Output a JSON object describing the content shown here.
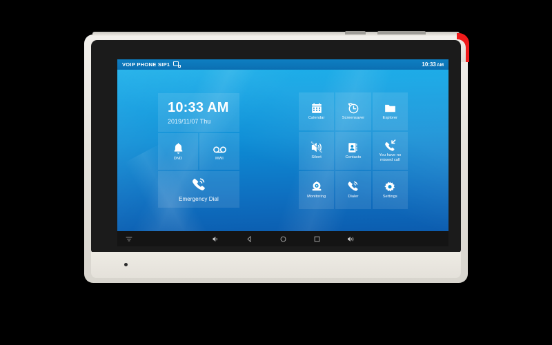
{
  "device": {
    "name": "voip-video-phone",
    "accent_color": "#f01b1b",
    "bezel_color": "#1b1b1b",
    "body_color": "#e9e6df"
  },
  "screen": {
    "background_colors": [
      "#00a9e8",
      "#0d8ed6",
      "#0b55a8"
    ],
    "statusbar": {
      "title": "VOIP PHONE SIP1",
      "network_icon": "network-icon",
      "time": "10:33",
      "ampm": "AM",
      "bg_color": "#0e7fc2"
    },
    "left_panel": {
      "clock": {
        "time": "10:33 AM",
        "date": "2019/11/07 Thu"
      },
      "tiles": [
        {
          "id": "dnd",
          "label": "DND",
          "icon": "bell-icon"
        },
        {
          "id": "mwi",
          "label": "MWI",
          "icon": "voicemail-icon"
        }
      ],
      "emergency": {
        "label": "Emergency Dial",
        "icon": "phone-ring-icon"
      }
    },
    "right_grid": {
      "tiles": [
        {
          "id": "calendar",
          "label": "Calendar",
          "icon": "calendar-icon"
        },
        {
          "id": "screensaver",
          "label": "Screensaver",
          "icon": "clock-rotate-icon"
        },
        {
          "id": "explorer",
          "label": "Explorer",
          "icon": "folder-icon"
        },
        {
          "id": "silent",
          "label": "Silent",
          "icon": "speaker-mute-icon"
        },
        {
          "id": "contacts",
          "label": "Contacts",
          "icon": "address-book-icon"
        },
        {
          "id": "missed-call",
          "label": "You have no missed call",
          "icon": "phone-missed-icon"
        },
        {
          "id": "monitoring",
          "label": "Monitoring",
          "icon": "camera-icon"
        },
        {
          "id": "dialer",
          "label": "Dialer",
          "icon": "phone-ring-icon"
        },
        {
          "id": "settings",
          "label": "Settings",
          "icon": "gear-icon"
        }
      ]
    },
    "navbar": {
      "bg_color": "#141414",
      "buttons": [
        {
          "id": "menu",
          "icon": "menu-icon"
        },
        {
          "id": "volume-down",
          "icon": "volume-down-icon"
        },
        {
          "id": "back",
          "icon": "back-triangle-icon"
        },
        {
          "id": "home",
          "icon": "home-circle-icon"
        },
        {
          "id": "recents",
          "icon": "recents-square-icon"
        },
        {
          "id": "volume-up",
          "icon": "volume-up-icon"
        }
      ]
    }
  }
}
